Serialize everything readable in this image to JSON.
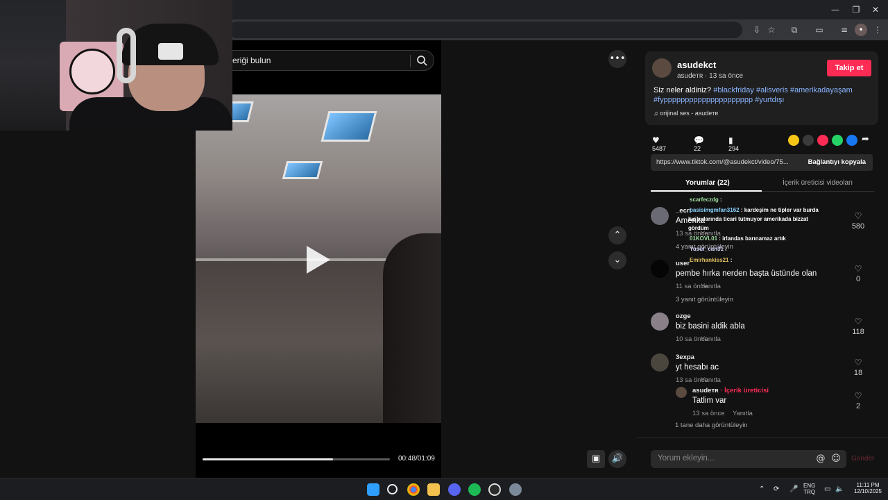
{
  "window": {
    "minimize": "—",
    "restore": "❐",
    "close": "✕"
  },
  "toolbar_icons": [
    "install-icon",
    "star-icon",
    "extensions-icon",
    "sidepanel-icon",
    "media-icon",
    "profile-icon",
    "menu-icon"
  ],
  "search": {
    "placeholder": "eriği bulun"
  },
  "video": {
    "progress_fraction": 0.698,
    "time": "00:48/01:09"
  },
  "author": {
    "username": "asudekct",
    "display": "asudeᴛʀ",
    "time_ago": "13 sa önce",
    "follow_label": "Takip et",
    "caption_prefix": "Siz neler aldiniz? ",
    "hashtags": [
      "#blackfriday",
      "#alisveris",
      "#amerikadayaşam",
      "#fyppppppppppppppppppppp",
      "#yurtdışı"
    ],
    "music": "orijinal ses - asudeᴛʀ"
  },
  "stats": {
    "likes": "5487",
    "comments": "22",
    "saves": "294"
  },
  "share_colors": [
    "#f5c518",
    "#3a3a3a",
    "#fe2c55",
    "#25d366",
    "#1877f2"
  ],
  "link": {
    "url": "https://www.tiktok.com/@asudekct/video/75...",
    "copy_label": "Bağlantıyı kopyala"
  },
  "tabs": {
    "comments": "Yorumlar (22)",
    "creator_videos": "İçerik üreticisi videoları"
  },
  "comments": [
    {
      "user": "_ecri",
      "text": "Amerika",
      "time": "13 sa önce",
      "reply": "Yanıtla",
      "more": "4 yanıt görüntüleyin",
      "likes": "580"
    },
    {
      "user": "user",
      "text": "pembe hırka nerden başta üstünde olan",
      "time": "11 sa önce",
      "reply": "Yanıtla",
      "more": "3 yanıt görüntüleyin",
      "likes": "0"
    },
    {
      "user": "ozge",
      "text": "biz basini aldik abla",
      "time": "10 sa önce",
      "reply": "Yanıtla",
      "more": "",
      "likes": "118"
    },
    {
      "user": "3expa",
      "text": "yt hesabı ac",
      "time": "13 sa önce",
      "reply": "Yanıtla",
      "more": "",
      "likes": "18"
    }
  ],
  "reply": {
    "user": "asudeᴛʀ",
    "badge": "· İçerik üreticisi",
    "text": "Tatlim var",
    "time": "13 sa önce",
    "reply": "Yanıtla",
    "likes": "2",
    "more": "1 tane daha görüntüleyin"
  },
  "comment_input": {
    "placeholder": "Yorum ekleyin...",
    "send": "Gönder"
  },
  "chat": [
    {
      "user": "scarfeczdg",
      "msg": ":",
      "color": "#9fe09f"
    },
    {
      "user": "pasisimgmfan3162",
      "msg": ": kardeşim ne tipler var burda",
      "color": "#8ad4ff"
    },
    {
      "user": "",
      "msg": "kış aylarında ticari tutmuyor amerikada bizzat",
      "color": "#ffffff"
    },
    {
      "user": "",
      "msg": "gördüm",
      "color": "#ffffff"
    },
    {
      "user": "01KOVL01",
      "msg": ": irlandas barınamaz artık",
      "color": "#9fe09f"
    },
    {
      "user": "Yusuf_can31",
      "msg": ":",
      "color": "#d7d7ff"
    },
    {
      "user": "Emirhankiss21",
      "msg": ":",
      "color": "#e0c060"
    }
  ],
  "tray": {
    "lang1": "ENG",
    "lang2": "TRQ",
    "time": "11:11 PM",
    "date": "12/10/2025"
  },
  "taskbar_apps": [
    "windows-start",
    "search",
    "chrome",
    "file-explorer",
    "discord",
    "spotify",
    "steam",
    "settings"
  ]
}
